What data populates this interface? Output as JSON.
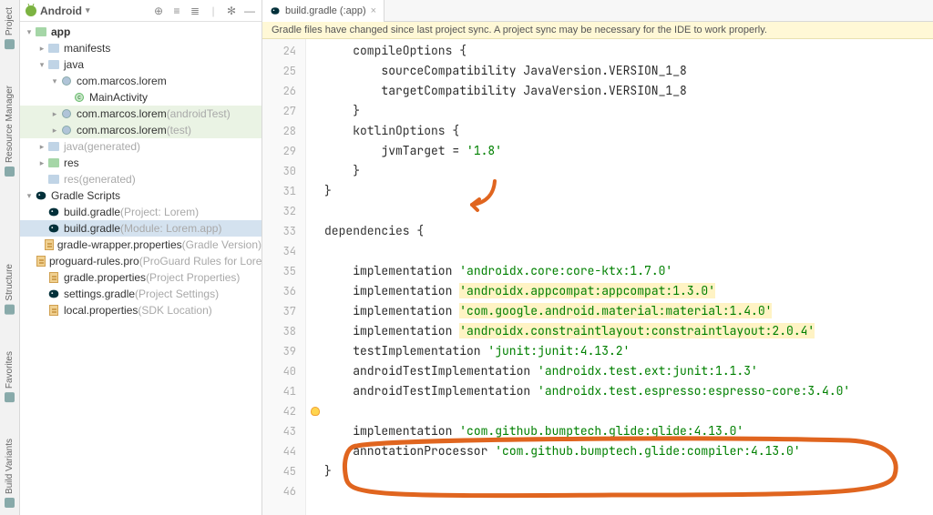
{
  "sidebar": {
    "title": "Android",
    "tree": {
      "app": "app",
      "manifests": "manifests",
      "java": "java",
      "pkg1": "com.marcos.lorem",
      "main_activity": "MainActivity",
      "pkg2": "com.marcos.lorem",
      "pkg2_suffix": " (androidTest)",
      "pkg3": "com.marcos.lorem",
      "pkg3_suffix": " (test)",
      "java_gen": "java",
      "java_gen_suffix": " (generated)",
      "res": "res",
      "res_gen": "res",
      "res_gen_suffix": " (generated)",
      "gradle_scripts": "Gradle Scripts",
      "bg_project": "build.gradle",
      "bg_project_suffix": " (Project: Lorem)",
      "bg_module": "build.gradle",
      "bg_module_suffix": " (Module: Lorem.app)",
      "gwp": "gradle-wrapper.properties",
      "gwp_suffix": " (Gradle Version)",
      "proguard": "proguard-rules.pro",
      "proguard_suffix": " (ProGuard Rules for Lorem.app)",
      "gp": "gradle.properties",
      "gp_suffix": " (Project Properties)",
      "sg": "settings.gradle",
      "sg_suffix": " (Project Settings)",
      "lp": "local.properties",
      "lp_suffix": " (SDK Location)"
    }
  },
  "left_gutter": {
    "project": "Project",
    "resource_manager": "Resource Manager",
    "structure": "Structure",
    "favorites": "Favorites",
    "build_variants": "Build Variants"
  },
  "tab": {
    "label": "build.gradle (:app)"
  },
  "banner": "Gradle files have changed since last project sync. A project sync may be necessary for the IDE to work properly.",
  "code": {
    "l24": {
      "indent": "    ",
      "a": "compileOptions ",
      "b": "{"
    },
    "l25": {
      "indent": "        ",
      "a": "sourceCompatibility JavaVersion.VERSION_1_8"
    },
    "l26": {
      "indent": "        ",
      "a": "targetCompatibility JavaVersion.VERSION_1_8"
    },
    "l27": {
      "indent": "    ",
      "a": "}"
    },
    "l28": {
      "indent": "    ",
      "a": "kotlinOptions ",
      "b": "{"
    },
    "l29": {
      "indent": "        ",
      "a": "jvmTarget = ",
      "b": "'1.8'"
    },
    "l30": {
      "indent": "    ",
      "a": "}"
    },
    "l31": {
      "a": "}"
    },
    "l33": {
      "a": "dependencies ",
      "b": "{"
    },
    "l35": {
      "indent": "    ",
      "a": "implementation ",
      "b": "'androidx.core:core-ktx:1.7.0'"
    },
    "l36": {
      "indent": "    ",
      "a": "implementation ",
      "b": "'androidx.appcompat:appcompat:1.3.0'"
    },
    "l37": {
      "indent": "    ",
      "a": "implementation ",
      "b": "'com.google.android.material:material:1.4.0'"
    },
    "l38": {
      "indent": "    ",
      "a": "implementation ",
      "b": "'androidx.constraintlayout:constraintlayout:2.0.4'"
    },
    "l39": {
      "indent": "    ",
      "a": "testImplementation ",
      "b": "'junit:junit:4.13.2'"
    },
    "l40": {
      "indent": "    ",
      "a": "androidTestImplementation ",
      "b": "'androidx.test.ext:junit:1.1.3'"
    },
    "l41": {
      "indent": "    ",
      "a": "androidTestImplementation ",
      "b": "'androidx.test.espresso:espresso-core:3.4.0'"
    },
    "l43": {
      "indent": "    ",
      "a": "implementation ",
      "b": "'com.github.bumptech.glide:glide:4.13.0'"
    },
    "l44": {
      "indent": "    ",
      "a": "annotationProcessor ",
      "b": "'com.github.bumptech.glide:compiler:4.13.0'"
    },
    "l45": {
      "a": "}"
    }
  },
  "line_numbers": [
    "24",
    "25",
    "26",
    "27",
    "28",
    "29",
    "30",
    "31",
    "32",
    "33",
    "34",
    "35",
    "36",
    "37",
    "38",
    "39",
    "40",
    "41",
    "42",
    "43",
    "44",
    "45",
    "46"
  ]
}
